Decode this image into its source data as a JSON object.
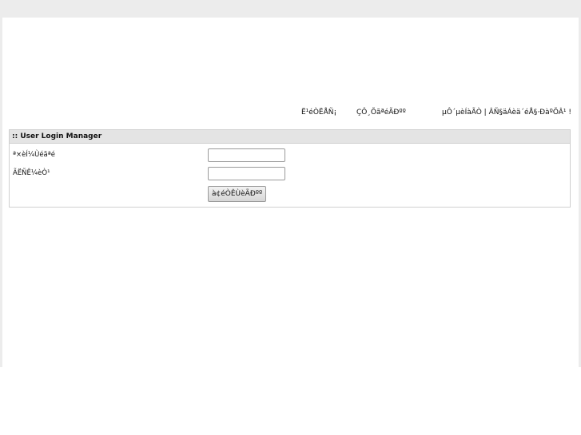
{
  "nav": {
    "links": [
      "Ë¹éÒËÅÑ¡",
      "ÇÔ¸ÕãªéÃÐºº",
      "µÔ´µèÍàÃÒ | ÂÑ§äÁèä´éÅ§·ÐàºÕÂ¹ !"
    ]
  },
  "login": {
    "title": ":: User Login Manager",
    "username_label": "ª×èÍ¼Ùéãªé",
    "password_label": "ÃËÑÊ¼èÒ¹",
    "username_value": "",
    "password_value": "",
    "submit_label": "à¢éÒÊÙèÃÐºº"
  }
}
